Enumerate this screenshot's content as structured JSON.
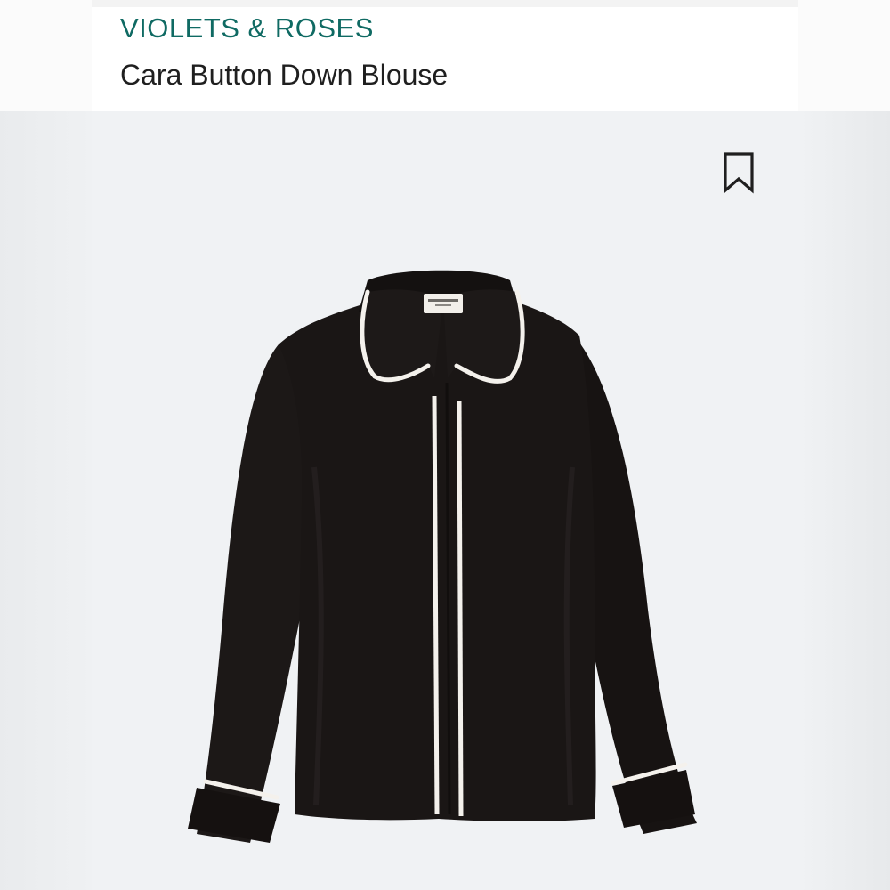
{
  "product": {
    "brand": "VIOLETS & ROSES",
    "name": "Cara Button Down Blouse"
  },
  "icons": {
    "save": "bookmark-icon"
  },
  "colors": {
    "brand": "#0f6a63",
    "title": "#1f1f1f",
    "garment": "#1c1817",
    "piping": "#f4f1ec"
  }
}
